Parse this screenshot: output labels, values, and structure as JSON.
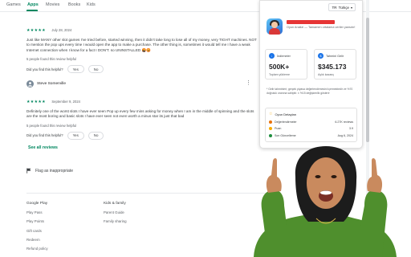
{
  "nav": {
    "items": [
      {
        "label": "Games",
        "active": false
      },
      {
        "label": "Apps",
        "active": true
      },
      {
        "label": "Movies",
        "active": false
      },
      {
        "label": "Books",
        "active": false
      },
      {
        "label": "Kids",
        "active": false
      }
    ]
  },
  "reviews": [
    {
      "stars": "★★★★★",
      "date": "July 28, 2024",
      "text": "Just like MANY other slot games I've tried before, started winning, then it didn't take long to lose all of my money, very TIGHT machines. NOT to mention the pop ups every time I would open the app to make a purchase. The other thing is, sometimes it would tell me I have a weak Internet connection when I know for a fact I DON'T. so UNINSTALLED 🤬😡",
      "helpful": "5 people found this review helpful",
      "question": "Did you find this helpful?",
      "yes": "Yes",
      "no": "No"
    },
    {
      "name": "Steve Somerville",
      "stars": "★★★★★",
      "date": "September 9, 2024",
      "text": "Definitely one of the worst slots I have ever seen Pop up every few mins asking for money when I am in the middle of spinning and the slots are the most boring and basic slots I have ever seen not even worth a minus star its just that bad",
      "helpful": "5 people found this review helpful",
      "question": "Did you find this helpful?",
      "yes": "Yes",
      "no": "No"
    }
  ],
  "see_all": "See all reviews",
  "flag": "Flag as inappropriate",
  "footer": {
    "col1": {
      "heading": "Google Play",
      "links": [
        "Play Pass",
        "Play Points",
        "Gift cards",
        "Redeem",
        "Refund policy"
      ]
    },
    "col2": {
      "heading": "Kids & family",
      "links": [
        "Parent Guide",
        "Family sharing"
      ]
    }
  },
  "extension": {
    "lang_code": "TR",
    "lang_label": "Türkçe",
    "app_sub": "Oyun Analizi — Tamamen ortalama veriler yansıtır!",
    "stats": [
      {
        "title": "İndirmeler",
        "value": "500K+",
        "sub": "Toplam yükleme",
        "icon": "download-icon"
      },
      {
        "title": "Tahmini Gelir",
        "value": "$345.173",
        "sub": "Aylık kazanç",
        "icon": "dollar-icon"
      }
    ],
    "note": "* Gelir tahminleri; gerçek piyasa değerlendirmesini içermektedir ve %70 doğruluk oranına sahiptir. ± %15 değişkenlik gösterir",
    "dev": {
      "title": "Oyun Detayları",
      "rows": [
        {
          "label": "Değerlendirmeler",
          "value": "6.27K reviews",
          "color": "#e8710a"
        },
        {
          "label": "Puan",
          "value": "3.9",
          "color": "#f9ab00"
        },
        {
          "label": "Son Güncelleme",
          "value": "Aug 6, 2024",
          "color": "#1e8e3e"
        }
      ]
    }
  },
  "colors": {
    "accent": "#01875f",
    "redaction": "#e63535",
    "shirt": "#4f8f2d"
  }
}
